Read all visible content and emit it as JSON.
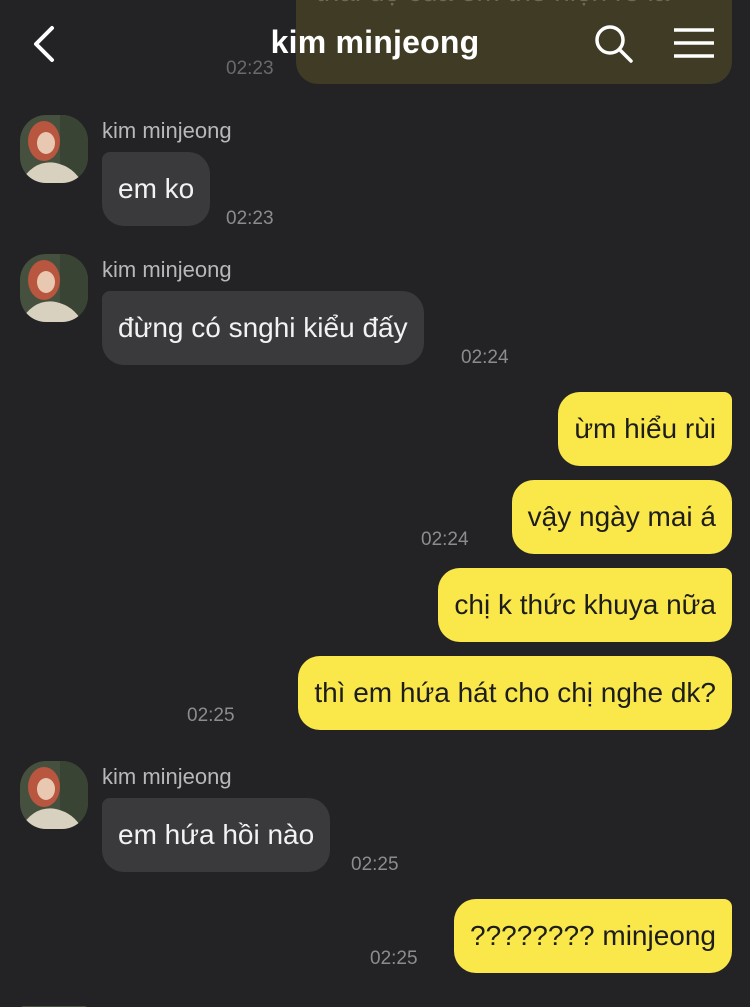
{
  "header": {
    "title": "kim minjeong",
    "icons": {
      "back": "chevron-left-icon",
      "search": "search-icon",
      "menu": "menu-icon"
    }
  },
  "colors": {
    "background": "#232325",
    "incoming_bubble": "#3a3a3d",
    "outgoing_bubble": "#fae84b",
    "timestamp": "#8c8c8e"
  },
  "previous_message": {
    "text": "thái độ của em thể hiện rõ là",
    "time": "02:23"
  },
  "messages": [
    {
      "sender": "kim minjeong",
      "text": "em ko",
      "time": "02:23"
    },
    {
      "sender": "kim minjeong",
      "text": "đừng có snghi kiểu đấy",
      "time": "02:24"
    },
    {
      "text": "ừm hiểu rùi"
    },
    {
      "text": "vậy ngày mai á",
      "time": "02:24"
    },
    {
      "text": "chị k thức khuya nữa"
    },
    {
      "text": "thì em hứa hát cho chị nghe dk?",
      "time": "02:25"
    },
    {
      "sender": "kim minjeong",
      "text": "em hứa hồi nào",
      "time": "02:25"
    },
    {
      "text": "???????? minjeong",
      "time": "02:25"
    }
  ]
}
